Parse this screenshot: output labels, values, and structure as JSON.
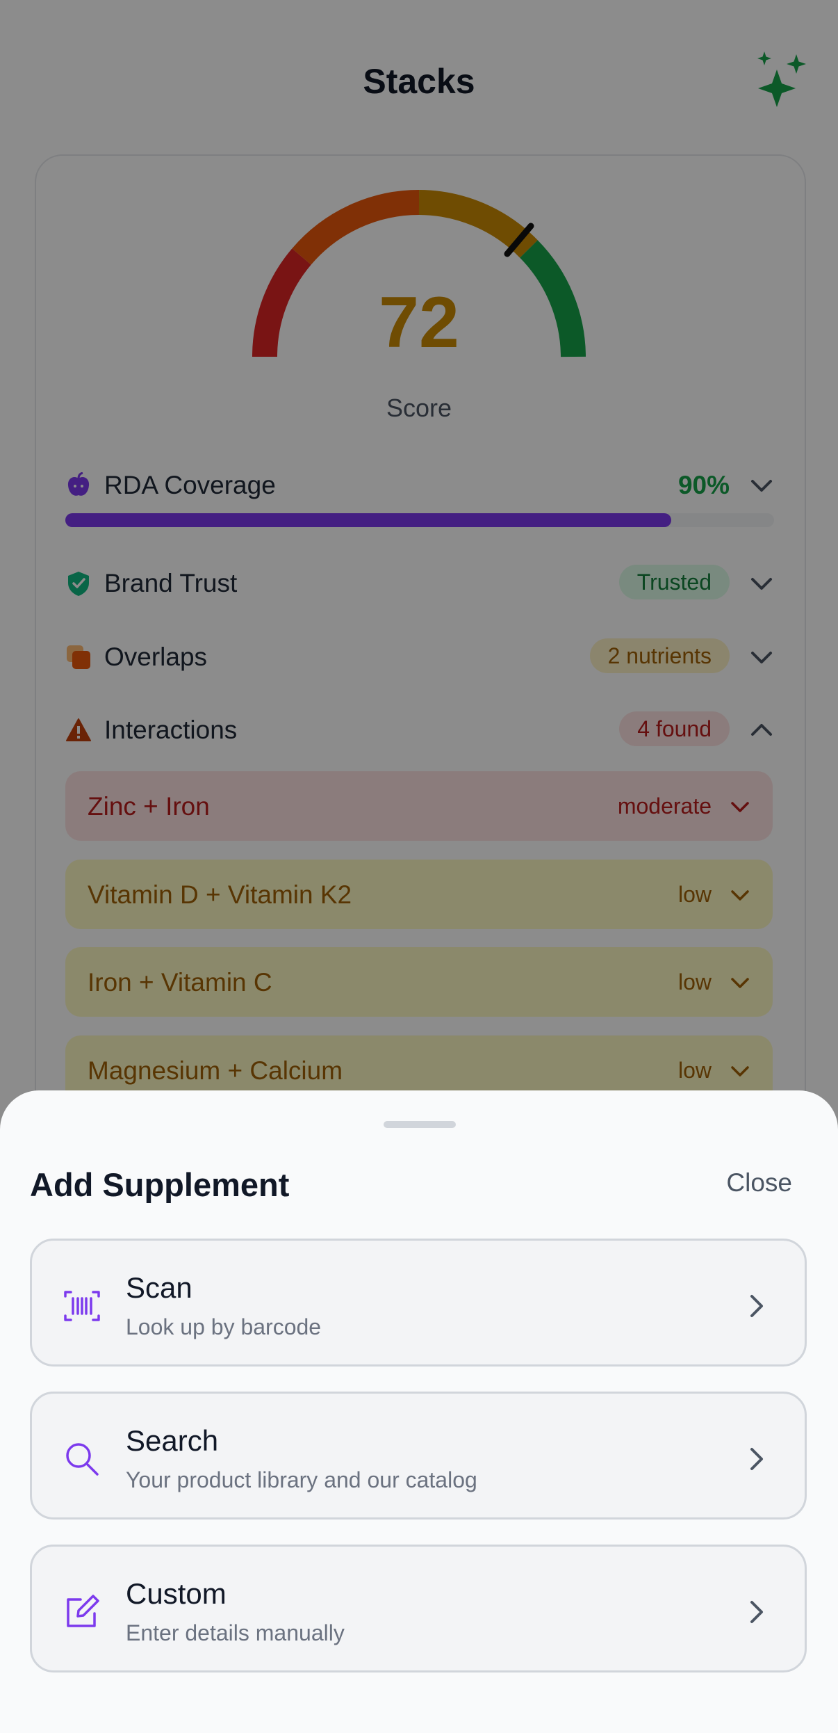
{
  "header": {
    "title": "Stacks",
    "ai_icon": "sparkles-icon"
  },
  "score": {
    "value": "72",
    "label": "Score",
    "value_fraction": 0.72
  },
  "metrics": {
    "rda": {
      "label": "RDA Coverage",
      "value": "90%",
      "fraction": 0.9,
      "icon": "apple-icon"
    },
    "brand": {
      "label": "Brand Trust",
      "badge": "Trusted",
      "icon": "shield-check-icon"
    },
    "overlaps": {
      "label": "Overlaps",
      "badge": "2 nutrients",
      "icon": "layers-icon"
    },
    "interactions": {
      "label": "Interactions",
      "badge": "4 found",
      "icon": "warning-icon"
    }
  },
  "interactions_list": [
    {
      "name": "Zinc + Iron",
      "severity": "moderate"
    },
    {
      "name": "Vitamin D + Vitamin K2",
      "severity": "low"
    },
    {
      "name": "Iron + Vitamin C",
      "severity": "low"
    },
    {
      "name": "Magnesium + Calcium",
      "severity": "low"
    }
  ],
  "sheet": {
    "title": "Add Supplement",
    "close_label": "Close",
    "options": [
      {
        "title": "Scan",
        "subtitle": "Look up by barcode",
        "icon": "barcode-icon"
      },
      {
        "title": "Search",
        "subtitle": "Your product library and our catalog",
        "icon": "search-icon"
      },
      {
        "title": "Custom",
        "subtitle": "Enter details manually",
        "icon": "edit-icon"
      }
    ]
  },
  "colors": {
    "accent": "#7c3aed",
    "success": "#16a34a",
    "warning": "#ca8a04",
    "danger": "#dc2626"
  }
}
